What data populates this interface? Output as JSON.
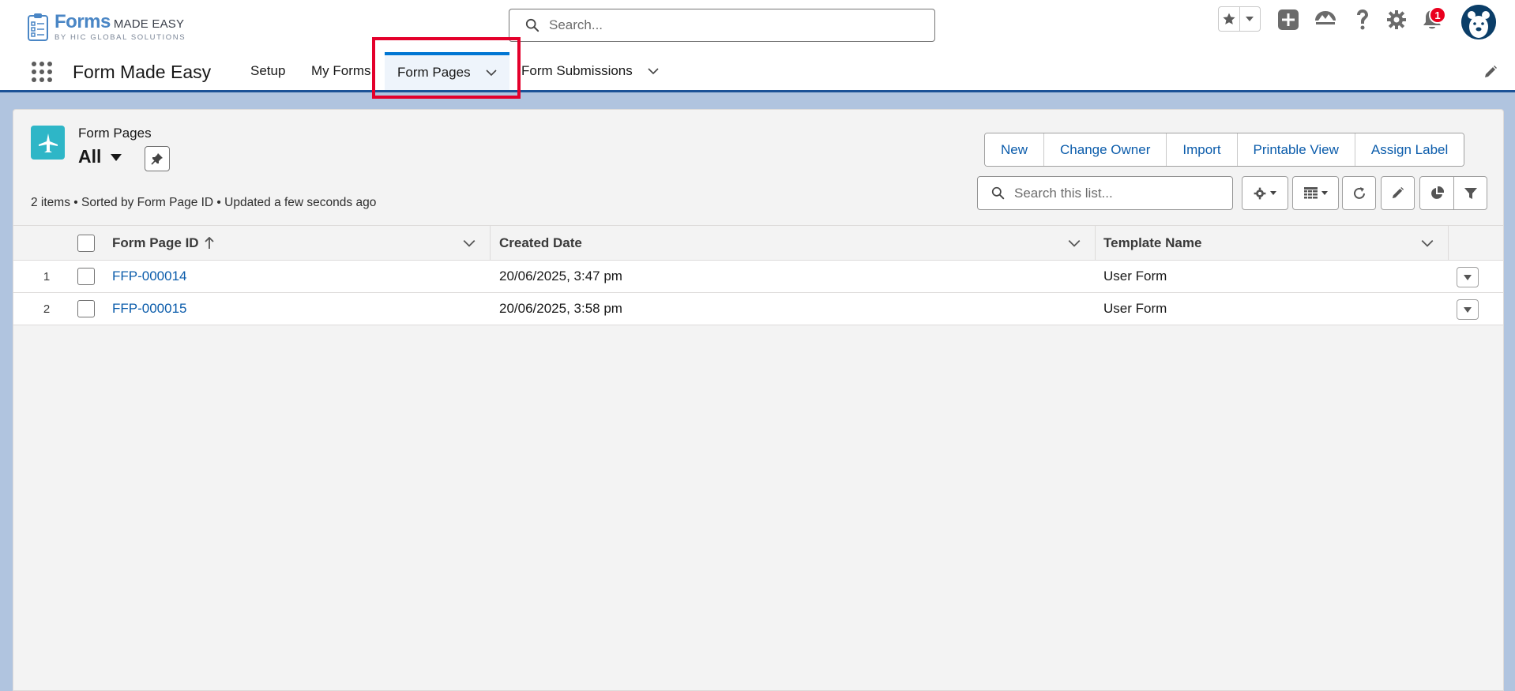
{
  "brand": {
    "name_main": "Forms",
    "name_suffix": "MADE EASY",
    "tagline": "BY HIC GLOBAL SOLUTIONS"
  },
  "global_search": {
    "placeholder": "Search..."
  },
  "header_icons": [
    "favorites-star-icon",
    "favorites-dropdown-icon",
    "global-actions-plus-icon",
    "trailhead-icon",
    "help-icon",
    "setup-gear-icon",
    "notifications-bell-icon",
    "avatar"
  ],
  "notifications": {
    "count": "1"
  },
  "nav": {
    "app_name": "Form Made Easy",
    "items": [
      {
        "label": "Setup",
        "active": false,
        "has_menu": false
      },
      {
        "label": "My Forms",
        "active": false,
        "has_menu": false
      },
      {
        "label": "Form Pages",
        "active": true,
        "has_menu": true
      },
      {
        "label": "Form Submissions",
        "active": false,
        "has_menu": true
      }
    ]
  },
  "list_view": {
    "object_label": "Form Pages",
    "view_name": "All",
    "meta": "2 items • Sorted by Form Page ID • Updated a few seconds ago",
    "actions": [
      "New",
      "Change Owner",
      "Import",
      "Printable View",
      "Assign Label"
    ],
    "search_placeholder": "Search this list...",
    "toolbar_icons": [
      "list-settings-gear-icon",
      "display-as-table-icon",
      "refresh-icon",
      "edit-list-icon",
      "chart-icon",
      "filter-icon"
    ]
  },
  "table": {
    "columns": [
      "Form Page ID",
      "Created Date",
      "Template Name"
    ],
    "sort_column": "Form Page ID",
    "sort_direction": "ascending",
    "rows": [
      {
        "num": "1",
        "id": "FFP-000014",
        "created": "20/06/2025, 3:47 pm",
        "template": "User Form"
      },
      {
        "num": "2",
        "id": "FFP-000015",
        "created": "20/06/2025, 3:58 pm",
        "template": "User Form"
      }
    ]
  },
  "colors": {
    "brand_blue": "#0176d3",
    "link_blue": "#0b5cab",
    "nav_underline": "#1b5297",
    "object_icon_teal": "#2eb6c7",
    "badge_red": "#ea001e",
    "highlight_red": "#e4002b"
  }
}
